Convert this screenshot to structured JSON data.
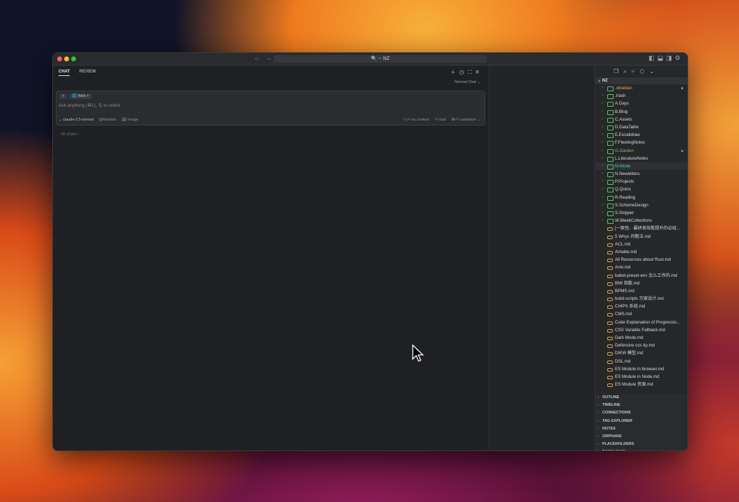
{
  "titlebar": {
    "search": "🔍 -- NZ"
  },
  "chat": {
    "tabs": [
      "CHAT",
      "REVIEW"
    ],
    "mode": "Normal Chat ⌄",
    "chip_web": "🌐 Web ×",
    "placeholder": "Ask anything (⌘L), ⇅ to select",
    "model": "⌄ claude-3.5-sonnet",
    "mention": "@Mention",
    "image": "🖼 Image",
    "no_context": "⌥⏎ no context",
    "chat_btn": "⏎ chat",
    "codebase": "⌘⏎ codebase ⌄",
    "all_chats": "All chats ›"
  },
  "sidebar": {
    "vault": "NZ",
    "folders": [
      {
        "label": ".obsidian",
        "color": "#e3b253",
        "dot": true
      },
      {
        "label": ".trash",
        "color": "#d8dade",
        "dot": false
      },
      {
        "label": "A.Days",
        "color": "#d8dade",
        "dot": false
      },
      {
        "label": "B.Blog",
        "color": "#d8dade",
        "dot": false
      },
      {
        "label": "C.Assets",
        "color": "#d8dade",
        "dot": false
      },
      {
        "label": "D.DataTable",
        "color": "#d8dade",
        "dot": false
      },
      {
        "label": "E.Excalidraw",
        "color": "#d8dade",
        "dot": false
      },
      {
        "label": "F.FleetingNotes",
        "color": "#d8dade",
        "dot": false
      },
      {
        "label": "G.Garden",
        "color": "#7cc36a",
        "dot": true
      },
      {
        "label": "L.LiteratureNotes",
        "color": "#d8dade",
        "dot": false
      },
      {
        "label": "M.Mode",
        "color": "#4fd1a0",
        "dot": false,
        "highlight": true
      },
      {
        "label": "N.Newletters",
        "color": "#d8dade",
        "dot": false
      },
      {
        "label": "P.Projects",
        "color": "#d8dade",
        "dot": false
      },
      {
        "label": "Q.Qutos",
        "color": "#d8dade",
        "dot": false
      },
      {
        "label": "R.Reading",
        "color": "#d8dade",
        "dot": false
      },
      {
        "label": "S.SchemeDesign",
        "color": "#d8dade",
        "dot": false
      },
      {
        "label": "S.Snippet",
        "color": "#d8dade",
        "dot": false
      },
      {
        "label": "W.WeekCollections",
        "color": "#d8dade",
        "dot": false
      }
    ],
    "files": [
      "[一致性、最研发效能提升的必经...",
      "5 Whys 问题法.md",
      "ACL.md",
      "Airtable.md",
      "All Resources about Rust.md",
      "Anki.md",
      "babel-preset-env 怎么工作的.md",
      "BMI 指数.md",
      "BPMS.md",
      "build-scripts 方案设计.md",
      "CHIPS 系统.md",
      "CMS.md",
      "Code Explaination of Progressiv...",
      "CSS Variable Fallback.md",
      "Dark Mode.md",
      "Defensive css tip.md",
      "DIKW 模型.md",
      "DSL.md",
      "ES Module in browser.md",
      "ES Module in Node.md",
      "ES Module 资源.md"
    ],
    "sections": [
      "OUTLINE",
      "TIMELINE",
      "CONNECTIONS",
      "TAG EXPLORER",
      "NOTES",
      "ORPHANS",
      "PLACEHOLDERS",
      "BACKLINKS"
    ]
  }
}
